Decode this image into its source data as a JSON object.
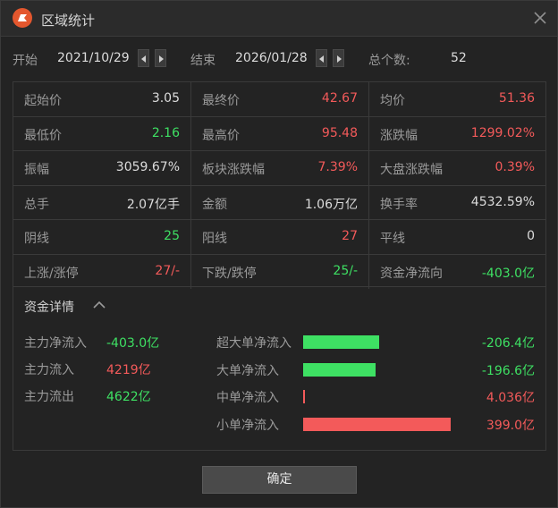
{
  "window": {
    "title": "区域统计",
    "close_icon": "close-icon",
    "app_icon": "flag-logo-icon"
  },
  "range": {
    "start_label": "开始",
    "start_date": "2021/10/29",
    "end_label": "结束",
    "end_date": "2026/01/28",
    "total_label": "总个数:",
    "total_value": "52"
  },
  "stats": [
    [
      {
        "k": "起始价",
        "v": "3.05",
        "c": "white"
      },
      {
        "k": "最终价",
        "v": "42.67",
        "c": "red"
      },
      {
        "k": "均价",
        "v": "51.36",
        "c": "red"
      }
    ],
    [
      {
        "k": "最低价",
        "v": "2.16",
        "c": "green"
      },
      {
        "k": "最高价",
        "v": "95.48",
        "c": "red"
      },
      {
        "k": "涨跌幅",
        "v": "1299.02%",
        "c": "red"
      }
    ],
    [
      {
        "k": "振幅",
        "v": "3059.67%",
        "c": "white"
      },
      {
        "k": "板块涨跌幅",
        "v": "7.39%",
        "c": "red"
      },
      {
        "k": "大盘涨跌幅",
        "v": "0.39%",
        "c": "red"
      }
    ],
    [
      {
        "k": "总手",
        "v": "2.07亿手",
        "c": "white"
      },
      {
        "k": "金额",
        "v": "1.06万亿",
        "c": "white"
      },
      {
        "k": "换手率",
        "v": "4532.59%",
        "c": "white"
      }
    ],
    [
      {
        "k": "阴线",
        "v": "25",
        "c": "green"
      },
      {
        "k": "阳线",
        "v": "27",
        "c": "red"
      },
      {
        "k": "平线",
        "v": "0",
        "c": "white"
      }
    ],
    [
      {
        "k": "上涨/涨停",
        "v": "27/-",
        "c": "red"
      },
      {
        "k": "下跌/跌停",
        "v": "25/-",
        "c": "green"
      },
      {
        "k": "资金净流向",
        "v": "-403.0亿",
        "c": "green"
      }
    ]
  ],
  "fund": {
    "title": "资金详情",
    "left": [
      {
        "k": "主力净流入",
        "v": "-403.0亿",
        "c": "green"
      },
      {
        "k": "主力流入",
        "v": "4219亿",
        "c": "red"
      },
      {
        "k": "主力流出",
        "v": "4622亿",
        "c": "green"
      }
    ],
    "right": [
      {
        "k": "超大单净流入",
        "v": "-206.4亿",
        "c": "green",
        "bar_color": "#3ee063",
        "magnitude": 206.4
      },
      {
        "k": "大单净流入",
        "v": "-196.6亿",
        "c": "green",
        "bar_color": "#3ee063",
        "magnitude": 196.6
      },
      {
        "k": "中单净流入",
        "v": "4.036亿",
        "c": "red",
        "bar_color": "#f35a5a",
        "magnitude": 4.036
      },
      {
        "k": "小单净流入",
        "v": "399.0亿",
        "c": "red",
        "bar_color": "#f35a5a",
        "magnitude": 399.0
      }
    ]
  },
  "footer": {
    "confirm_label": "确定"
  }
}
